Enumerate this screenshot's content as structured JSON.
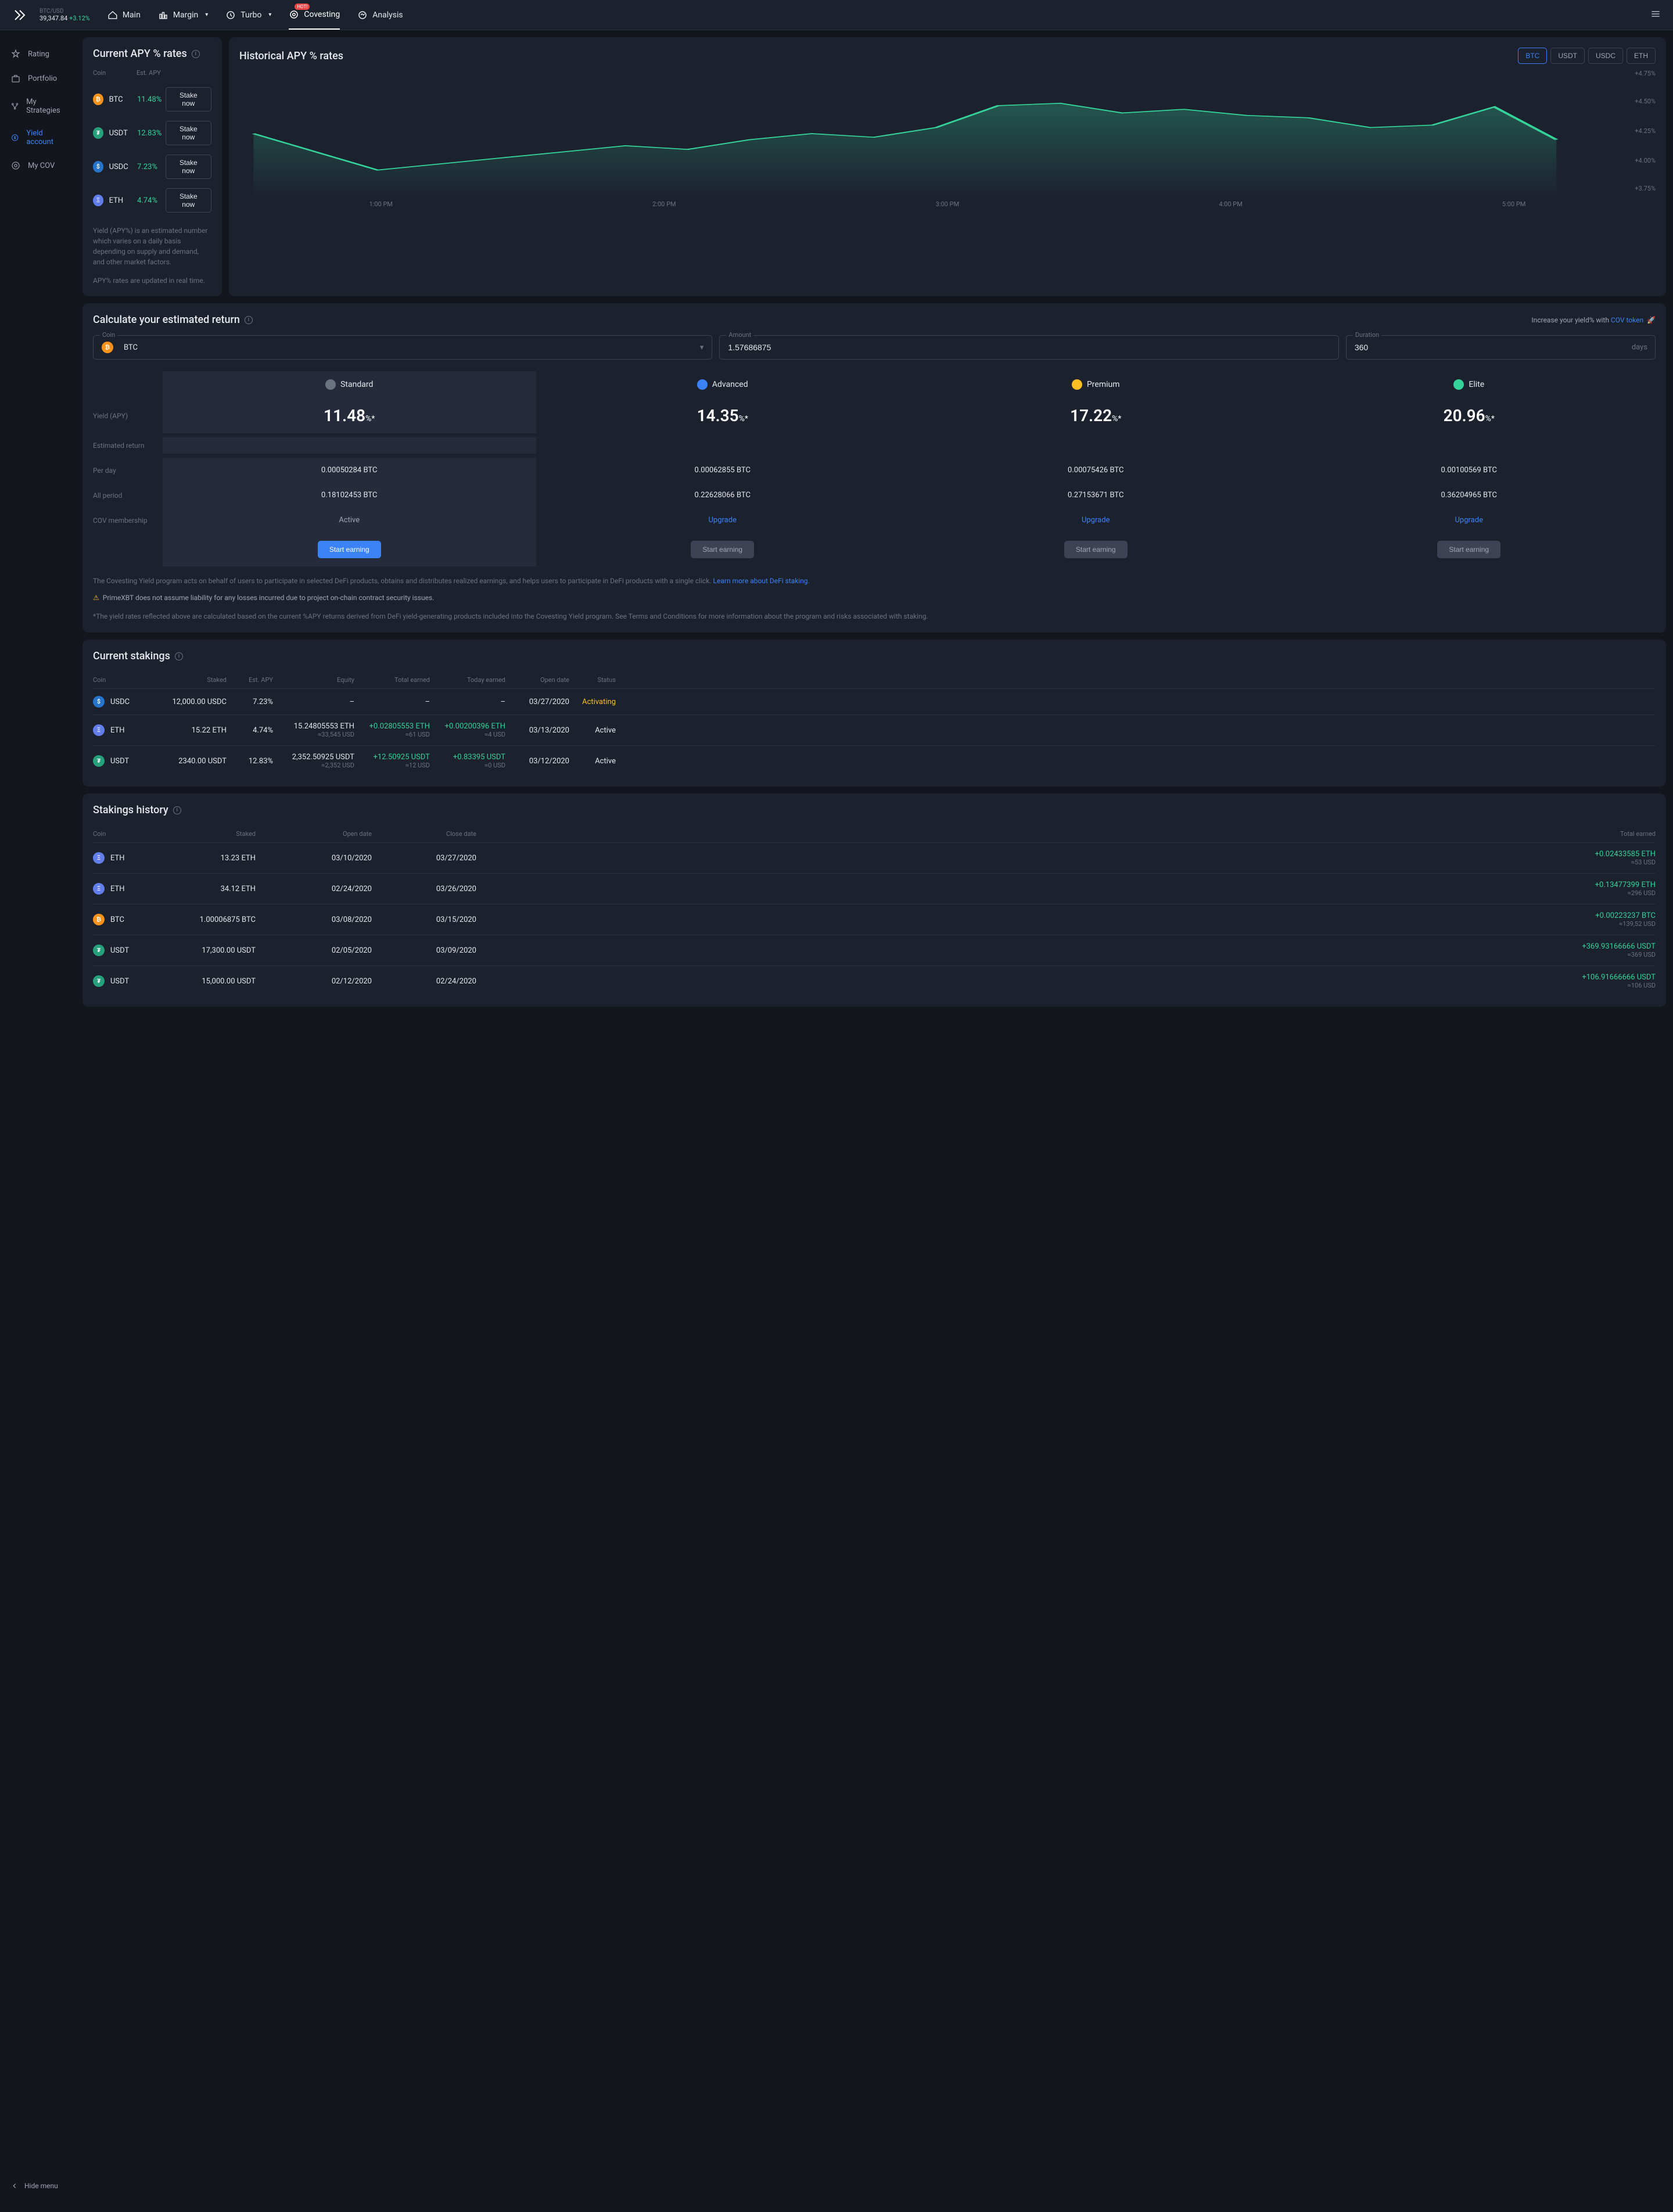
{
  "header": {
    "ticker_pair": "BTC/USD",
    "ticker_price": "39,347.84",
    "ticker_change": "+3.12%"
  },
  "nav": {
    "main": "Main",
    "margin": "Margin",
    "turbo": "Turbo",
    "covesting": "Covesting",
    "analysis": "Analysis",
    "badge": "HOT!"
  },
  "sidebar": {
    "rating": "Rating",
    "portfolio": "Portfolio",
    "strategies": "My Strategies",
    "yield": "Yield account",
    "mycov": "My COV",
    "hide": "Hide menu"
  },
  "apy_card": {
    "title": "Current APY % rates",
    "h_coin": "Coin",
    "h_apy": "Est. APY",
    "rows": [
      {
        "coin": "BTC",
        "apy": "11.48%",
        "btn": "Stake now",
        "cls": "coin-btc"
      },
      {
        "coin": "USDT",
        "apy": "12.83%",
        "btn": "Stake now",
        "cls": "coin-usdt"
      },
      {
        "coin": "USDC",
        "apy": "7.23%",
        "btn": "Stake now",
        "cls": "coin-usdc"
      },
      {
        "coin": "ETH",
        "apy": "4.74%",
        "btn": "Stake now",
        "cls": "coin-eth"
      }
    ],
    "note1": "Yield (APY%) is an estimated number which varies on a daily basis depending on supply and demand, and other market factors.",
    "note2": "APY% rates are updated in real time."
  },
  "chart": {
    "title": "Historical APY % rates",
    "tabs": [
      "BTC",
      "USDT",
      "USDC",
      "ETH"
    ],
    "y": [
      "+4.75%",
      "+4.50%",
      "+4.25%",
      "+4.00%",
      "+3.75%"
    ],
    "x": [
      "1:00 PM",
      "2:00 PM",
      "3:00 PM",
      "4:00 PM",
      "5:00 PM"
    ]
  },
  "calc": {
    "title": "Calculate your estimated return",
    "promo_pre": "Increase your yield% with ",
    "promo_link": "COV token",
    "promo_emoji": "🚀",
    "coin_label": "Coin",
    "coin_value": "BTC",
    "amount_label": "Amount",
    "amount_value": "1.57686875",
    "duration_label": "Duration",
    "duration_value": "360",
    "duration_suffix": "days",
    "tier_names": [
      "Standard",
      "Advanced",
      "Premium",
      "Elite"
    ],
    "tier_colors": [
      "#6b7280",
      "#3b82f6",
      "#fbbf24",
      "#34d399"
    ],
    "row_yield_label": "Yield (APY)",
    "row_est_label": "Estimated return",
    "row_day_label": "Per day",
    "row_period_label": "All period",
    "row_mem_label": "COV membership",
    "yields": [
      "11.48",
      "14.35",
      "17.22",
      "20.96"
    ],
    "yield_suffix": "%*",
    "per_day": [
      "0.00050284 BTC",
      "0.00062855 BTC",
      "0.00075426 BTC",
      "0.00100569 BTC"
    ],
    "all_period": [
      "0.18102453 BTC",
      "0.22628066 BTC",
      "0.27153671 BTC",
      "0.36204965 BTC"
    ],
    "membership": [
      "Active",
      "Upgrade",
      "Upgrade",
      "Upgrade"
    ],
    "start_btn": "Start earning",
    "note": "The Covesting Yield program acts on behalf of users to participate in selected DeFi products, obtains and distributes realized earnings, and helps users to participate in DeFi products with a single click. ",
    "note_link": "Learn more about DeFi staking.",
    "warn": "PrimeXBT does not assume liability for any losses incurred due to project on-chain contract security issues.",
    "disclaimer": "*The yield rates reflected above are calculated based on the current %APY returns derived from DeFi yield-generating products included into the Covesting Yield program. See Terms and Conditions for more information about the program and risks associated with staking."
  },
  "stakings": {
    "title": "Current stakings",
    "headers": [
      "Coin",
      "Staked",
      "Est. APY",
      "Equity",
      "Total earned",
      "Today earned",
      "Open date",
      "Status"
    ],
    "rows": [
      {
        "coin": "USDC",
        "cls": "coin-usdc",
        "staked": "12,000.00 USDC",
        "apy": "7.23%",
        "equity": "–",
        "equity_sub": "",
        "total": "–",
        "total_sub": "",
        "today": "–",
        "today_sub": "",
        "open": "03/27/2020",
        "status": "Activating",
        "status_cls": "cell-warn"
      },
      {
        "coin": "ETH",
        "cls": "coin-eth",
        "staked": "15.22 ETH",
        "apy": "4.74%",
        "equity": "15.24805553 ETH",
        "equity_sub": "≈33,545 USD",
        "total": "+0.02805553 ETH",
        "total_sub": "≈61 USD",
        "today": "+0.00200396 ETH",
        "today_sub": "≈4 USD",
        "open": "03/13/2020",
        "status": "Active",
        "status_cls": "cell-main"
      },
      {
        "coin": "USDT",
        "cls": "coin-usdt",
        "staked": "2340.00 USDT",
        "apy": "12.83%",
        "equity": "2,352.50925 USDT",
        "equity_sub": "≈2,352 USD",
        "total": "+12.50925 USDT",
        "total_sub": "≈12 USD",
        "today": "+0.83395 USDT",
        "today_sub": "≈0 USD",
        "open": "03/12/2020",
        "status": "Active",
        "status_cls": "cell-main"
      }
    ]
  },
  "history": {
    "title": "Stakings history",
    "headers": [
      "Coin",
      "Staked",
      "Open date",
      "Close date",
      "Total earned"
    ],
    "rows": [
      {
        "coin": "ETH",
        "cls": "coin-eth",
        "staked": "13.23 ETH",
        "open": "03/10/2020",
        "close": "03/27/2020",
        "earned": "+0.02433585 ETH",
        "sub": "≈53 USD"
      },
      {
        "coin": "ETH",
        "cls": "coin-eth",
        "staked": "34.12 ETH",
        "open": "02/24/2020",
        "close": "03/26/2020",
        "earned": "+0.13477399 ETH",
        "sub": "≈296 USD"
      },
      {
        "coin": "BTC",
        "cls": "coin-btc",
        "staked": "1.00006875 BTC",
        "open": "03/08/2020",
        "close": "03/15/2020",
        "earned": "+0.00223237 BTC",
        "sub": "≈139,52 USD"
      },
      {
        "coin": "USDT",
        "cls": "coin-usdt",
        "staked": "17,300.00 USDT",
        "open": "02/05/2020",
        "close": "03/09/2020",
        "earned": "+369.93166666 USDT",
        "sub": "≈369 USD"
      },
      {
        "coin": "USDT",
        "cls": "coin-usdt",
        "staked": "15,000.00 USDT",
        "open": "02/12/2020",
        "close": "02/24/2020",
        "earned": "+106.91666666 USDT",
        "sub": "≈106 USD"
      }
    ]
  },
  "chart_data": {
    "type": "area",
    "title": "Historical APY % rates",
    "series_name": "BTC",
    "ylim": [
      3.75,
      4.75
    ],
    "x": [
      "1:00 PM",
      "2:00 PM",
      "3:00 PM",
      "4:00 PM",
      "5:00 PM"
    ],
    "values": [
      4.25,
      4.1,
      3.95,
      4.0,
      4.05,
      4.1,
      4.15,
      4.12,
      4.2,
      4.25,
      4.22,
      4.3,
      4.48,
      4.5,
      4.42,
      4.45,
      4.4,
      4.38,
      4.3,
      4.32,
      4.47,
      4.2
    ]
  }
}
